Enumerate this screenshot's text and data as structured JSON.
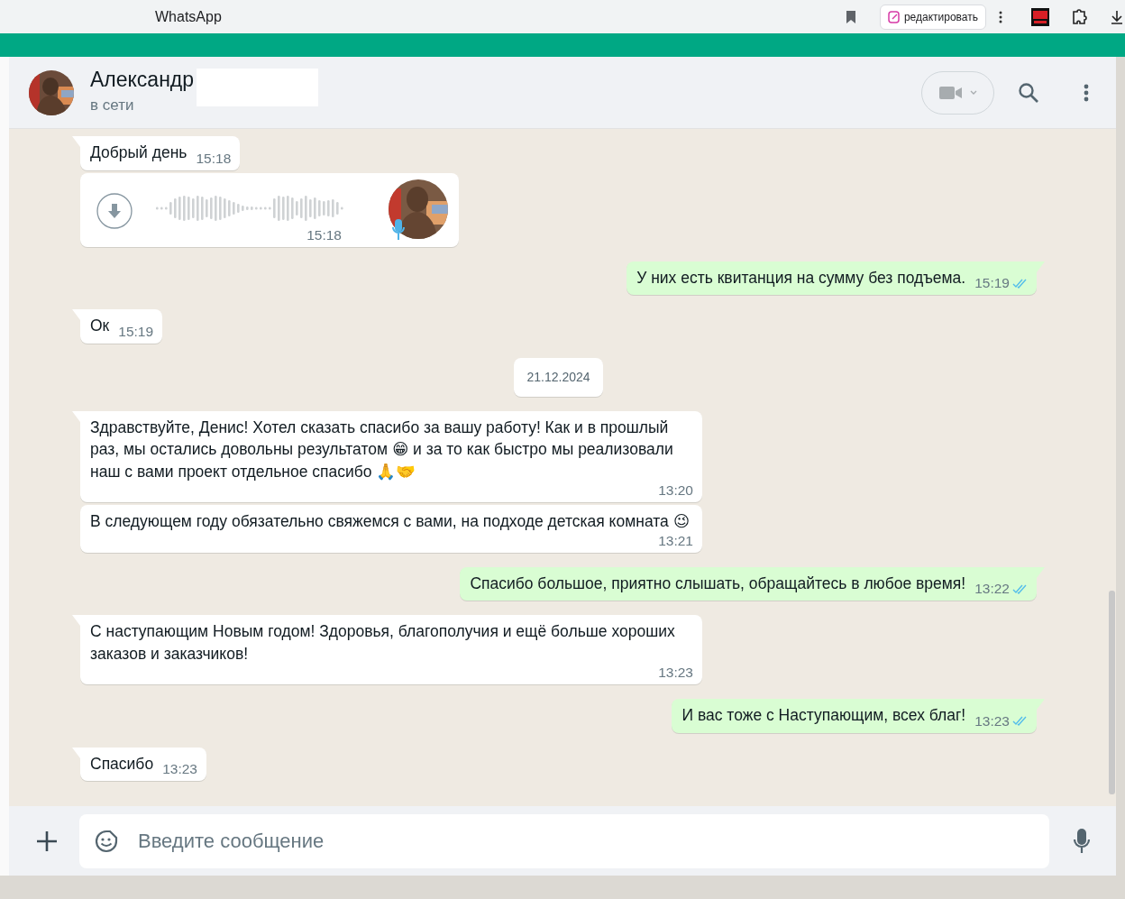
{
  "browser": {
    "tab_title": "WhatsApp",
    "edit_button": "редактировать"
  },
  "chat_header": {
    "name": "Александр",
    "status": "в сети"
  },
  "messages": [
    {
      "kind": "text",
      "outgoing": false,
      "tail": true,
      "text": "Добрый день",
      "time": "15:18"
    },
    {
      "kind": "voice",
      "outgoing": false,
      "tail": false,
      "time": "15:18"
    },
    {
      "kind": "text",
      "outgoing": true,
      "tail": true,
      "text": "У них есть квитанция на сумму без подъема.",
      "time": "15:19",
      "read": true
    },
    {
      "kind": "text",
      "outgoing": false,
      "tail": true,
      "text": "Ок",
      "time": "15:19"
    },
    {
      "kind": "date",
      "text": "21.12.2024"
    },
    {
      "kind": "text",
      "outgoing": false,
      "tail": true,
      "text": "Здравствуйте, Денис! Хотел сказать спасибо за вашу работу! Как и в прошлый раз, мы остались довольны результатом 😁 и за то как быстро мы реализовали наш с вами проект отдельное спасибо 🙏🤝",
      "time": "13:20"
    },
    {
      "kind": "text",
      "outgoing": false,
      "tail": false,
      "text": "В следующем году обязательно свяжемся с вами, на подходе детская комната 😉",
      "time": "13:21"
    },
    {
      "kind": "text",
      "outgoing": true,
      "tail": true,
      "text": "Спасибо большое, приятно слышать, обращайтесь в любое время!",
      "time": "13:22",
      "read": true
    },
    {
      "kind": "text",
      "outgoing": false,
      "tail": true,
      "text": "С наступающим Новым годом! Здоровья, благополучия и ещё больше хороших заказов и заказчиков!",
      "time": "13:23"
    },
    {
      "kind": "text",
      "outgoing": true,
      "tail": true,
      "text": "И вас тоже с Наступающим, всех благ!",
      "time": "13:23",
      "read": true
    },
    {
      "kind": "text",
      "outgoing": false,
      "tail": true,
      "text": "Спасибо",
      "time": "13:23"
    }
  ],
  "composer": {
    "placeholder": "Введите сообщение"
  }
}
